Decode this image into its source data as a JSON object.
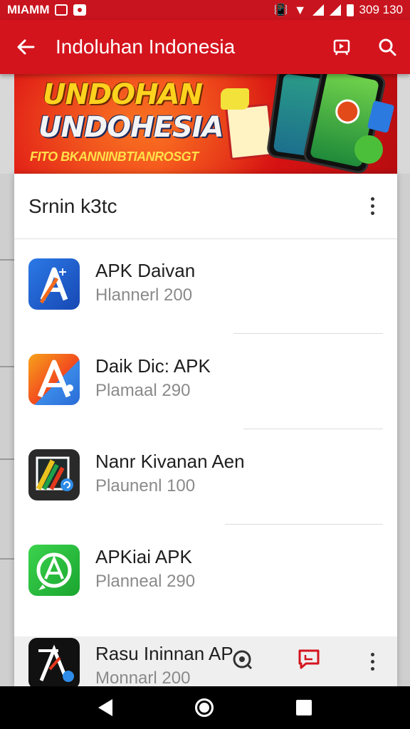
{
  "status_bar": {
    "carrier": "MIAMM",
    "time": "309 130"
  },
  "toolbar": {
    "title": "Indoluhan Indonesia",
    "icons": [
      "back-arrow-icon",
      "share-icon",
      "search-icon"
    ]
  },
  "banner": {
    "line1": "UNDOHAN",
    "line2": "UNDOHESIA",
    "tagline": "FITO BKANNINBTIANROSGT"
  },
  "sheet": {
    "title": "Srnin k3tc",
    "apps": [
      {
        "name": "APK Daivan",
        "subtitle": "Hlannerl 200",
        "icon": "apk-a-blue-icon",
        "color": "#1e5cc8"
      },
      {
        "name": "Daik Dic: APK",
        "subtitle": "Plamaal 290",
        "icon": "apk-a-orange-icon",
        "color": "#f26a1b"
      },
      {
        "name": "Nanr Kivanan Aen",
        "subtitle": "Plaunenl 100",
        "icon": "apk-a-dark-icon",
        "color": "#2c2c2c"
      },
      {
        "name": "APKiai APK",
        "subtitle": "Planneal 290",
        "icon": "apk-a-green-icon",
        "color": "#25c03a"
      }
    ],
    "bottom_app": {
      "name": "Rasu Ininnan AP",
      "subtitle": "Monnarl 200",
      "icon": "apk-a-black-icon"
    }
  },
  "colors": {
    "accent": "#d4141d",
    "status": "#c8141e"
  }
}
